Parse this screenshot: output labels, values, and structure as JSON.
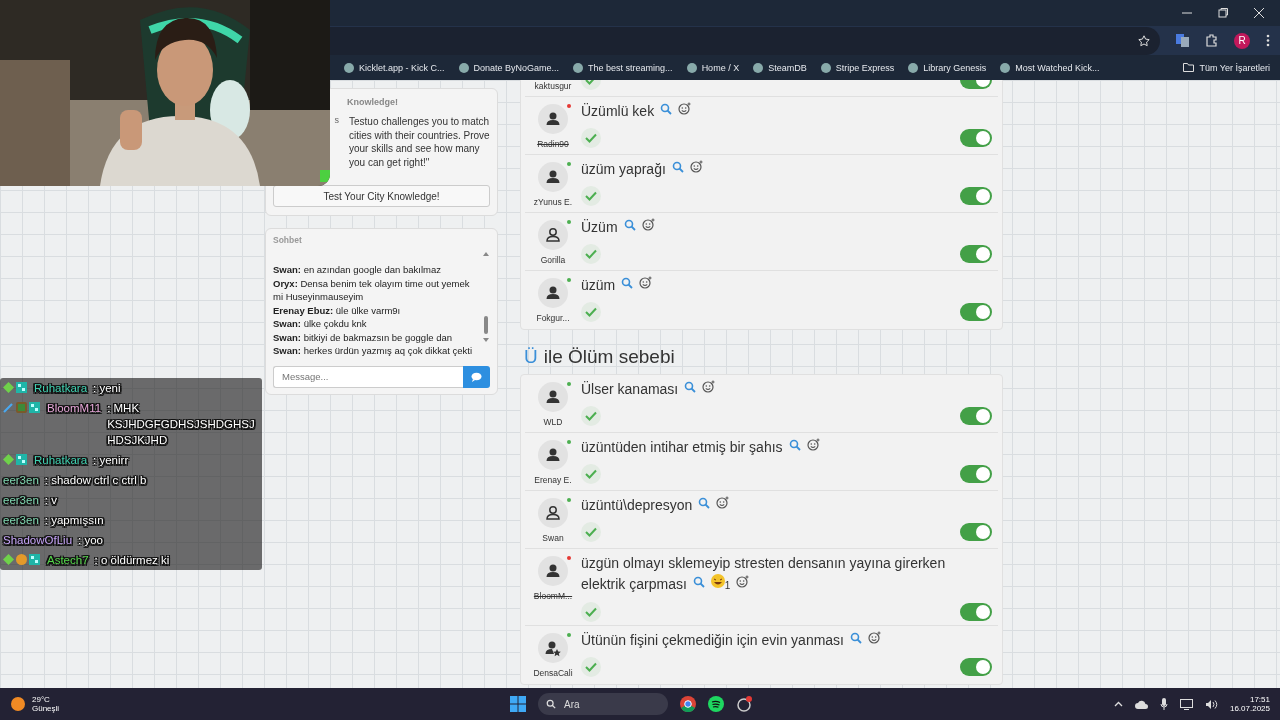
{
  "browser": {
    "profile_initial": "R",
    "bookmarks": [
      {
        "label": "Kicklet.app - Kick C..."
      },
      {
        "label": "Donate ByNoGame..."
      },
      {
        "label": "The best streaming..."
      },
      {
        "label": "Home / X"
      },
      {
        "label": "SteamDB"
      },
      {
        "label": "Stripe Express"
      },
      {
        "label": "Library Genesis"
      },
      {
        "label": "Most Watched Kick..."
      }
    ],
    "all_bookmarks": "Tüm Yer İşaretleri"
  },
  "quiz_card": {
    "title": "Knowledge!",
    "fragment": "s",
    "description": "Testuo challenges you to match cities with their countries. Prove your skills and see how many you can get right!\"",
    "button": "Test Your City Knowledge!"
  },
  "chat": {
    "title": "Sohbet",
    "messages": [
      {
        "user": "Swan:",
        "text": "en azından google dan bakılmaz"
      },
      {
        "user": "Oryx:",
        "text": "Densa benim tek olayım time out yemek mi Huseyinmauseyim"
      },
      {
        "user": "Erenay Ebuz:",
        "text": "üle ülke varm9ı"
      },
      {
        "user": "Swan:",
        "text": "ülke çokdu knk"
      },
      {
        "user": "Swan:",
        "text": "bitkiyi de bakmazsın be goggle dan"
      },
      {
        "user": "Swan:",
        "text": "herkes ürdün yazmış aq çok dikkat çekti"
      }
    ],
    "placeholder": "Message..."
  },
  "stream_chat": [
    {
      "kind": "subscriber",
      "user": "Ruhatkara",
      "color": "#3fd0b0",
      "text": ": yeni"
    },
    {
      "kind": "gifter",
      "user": "BloomM11",
      "color": "#e7a6d8",
      "text": ": MHK KSJHDGFGDHSJSHDGHSJHDSJKJHD"
    },
    {
      "kind": "subscriber",
      "user": "Ruhatkara",
      "color": "#3fd0b0",
      "text": ": yenirr"
    },
    {
      "kind": "plain",
      "user": "eer3en",
      "color": "#7fd6b0",
      "text": ": shadow ctrl c ctrl b"
    },
    {
      "kind": "plain",
      "user": "eer3en",
      "color": "#7fd6b0",
      "text": ": v"
    },
    {
      "kind": "plain",
      "user": "eer3en",
      "color": "#7fd6b0",
      "text": ": yapmışsın"
    },
    {
      "kind": "plain",
      "user": "ShadowOfLiu",
      "color": "#c4a2f5",
      "text": ": yoo"
    },
    {
      "kind": "founder",
      "user": "Astech7",
      "color": "#54d64a",
      "text": ": o öldürmez ki"
    }
  ],
  "sections": [
    {
      "answers": [
        {
          "user": "kaktusgur",
          "struck": false,
          "correct": true,
          "on": true
        },
        {
          "user": "Radin90",
          "kind": "person",
          "color": "#e53935",
          "struck": true,
          "text": "Üzümlü kek",
          "correct": true,
          "on": true
        },
        {
          "user": "zYunus E.",
          "kind": "person",
          "color": "#4caf50",
          "struck": false,
          "text": "üzüm yaprağı",
          "correct": true,
          "on": true
        },
        {
          "user": "Gorilla",
          "kind": "outline",
          "color": "#4caf50",
          "struck": false,
          "text": "Üzüm",
          "correct": true,
          "on": true
        },
        {
          "user": "Fokgur...",
          "kind": "person",
          "color": "#4caf50",
          "struck": false,
          "text": "üzüm",
          "correct": true,
          "on": true
        }
      ]
    },
    {
      "letter": "Ü",
      "title": "ile Ölüm sebebi",
      "answers": [
        {
          "user": "WLD",
          "kind": "person",
          "color": "#4caf50",
          "struck": false,
          "text": "Ülser kanaması",
          "correct": true,
          "on": true
        },
        {
          "user": "Erenay E.",
          "kind": "person",
          "color": "#4caf50",
          "struck": false,
          "text": "üzüntüden intihar etmiş bir şahıs",
          "correct": true,
          "on": true
        },
        {
          "user": "Swan",
          "kind": "outline",
          "color": "#4caf50",
          "struck": false,
          "text": "üzüntü\\depresyon",
          "correct": true,
          "on": true
        },
        {
          "user": "BloomM...",
          "kind": "person",
          "color": "#e53935",
          "struck": true,
          "text": "üzgün olmayı sklemeyip stresten densanın yayına girerken elektrik çarpması",
          "reaction_count": "1",
          "correct": true,
          "on": true
        },
        {
          "user": "DensaCali",
          "kind": "star",
          "color": "#4caf50",
          "struck": false,
          "text": "Ütünün fişini çekmediğin için evin yanması",
          "correct": true,
          "on": true
        }
      ]
    }
  ],
  "taskbar": {
    "temperature": "29°C",
    "weather": "Güneşli",
    "search": "Ara",
    "time": "17:51",
    "date": "16.07.2025"
  }
}
